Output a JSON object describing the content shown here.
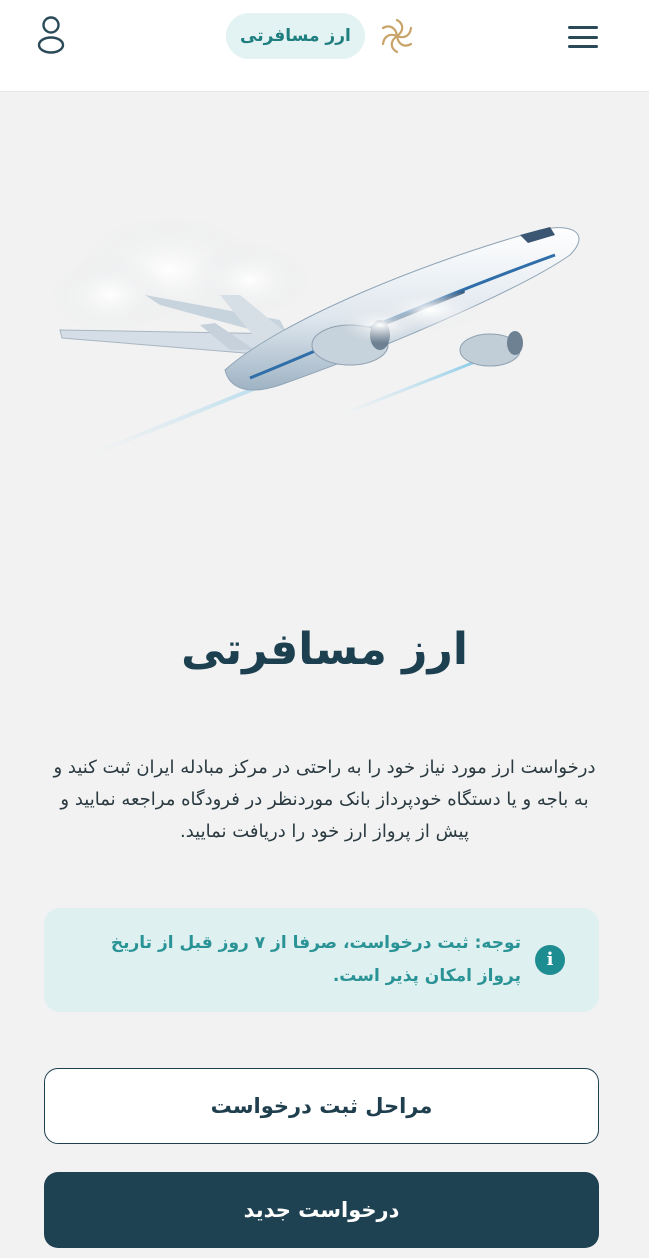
{
  "header": {
    "brand_label": "ارز مسافرتی",
    "menu_icon": "hamburger-menu-icon",
    "user_icon": "user-profile-icon",
    "logo_icon": "brand-logo-icon"
  },
  "hero": {
    "image": "airplane-illustration"
  },
  "main": {
    "title": "ارز مسافرتی",
    "description": "درخواست ارز مورد نیاز خود را به راحتی در مرکز مبادله ایران ثبت کنید و به باجه و یا دستگاه خودپرداز بانک موردنظر در فرودگاه مراجعه نمایید و پیش از پرواز ارز خود را دریافت نمایید.",
    "note": "توجه: ثبت درخواست، صرفا از ۷ روز قبل از تاریخ پرواز امکان پذیر است.",
    "note_icon": "info-icon"
  },
  "actions": {
    "steps_label": "مراحل ثبت درخواست",
    "new_request_label": "درخواست جدید"
  },
  "colors": {
    "primary": "#1f4252",
    "accent_teal": "#1e8d92",
    "note_bg": "#dff0f0",
    "page_bg": "#f2f2f2"
  }
}
